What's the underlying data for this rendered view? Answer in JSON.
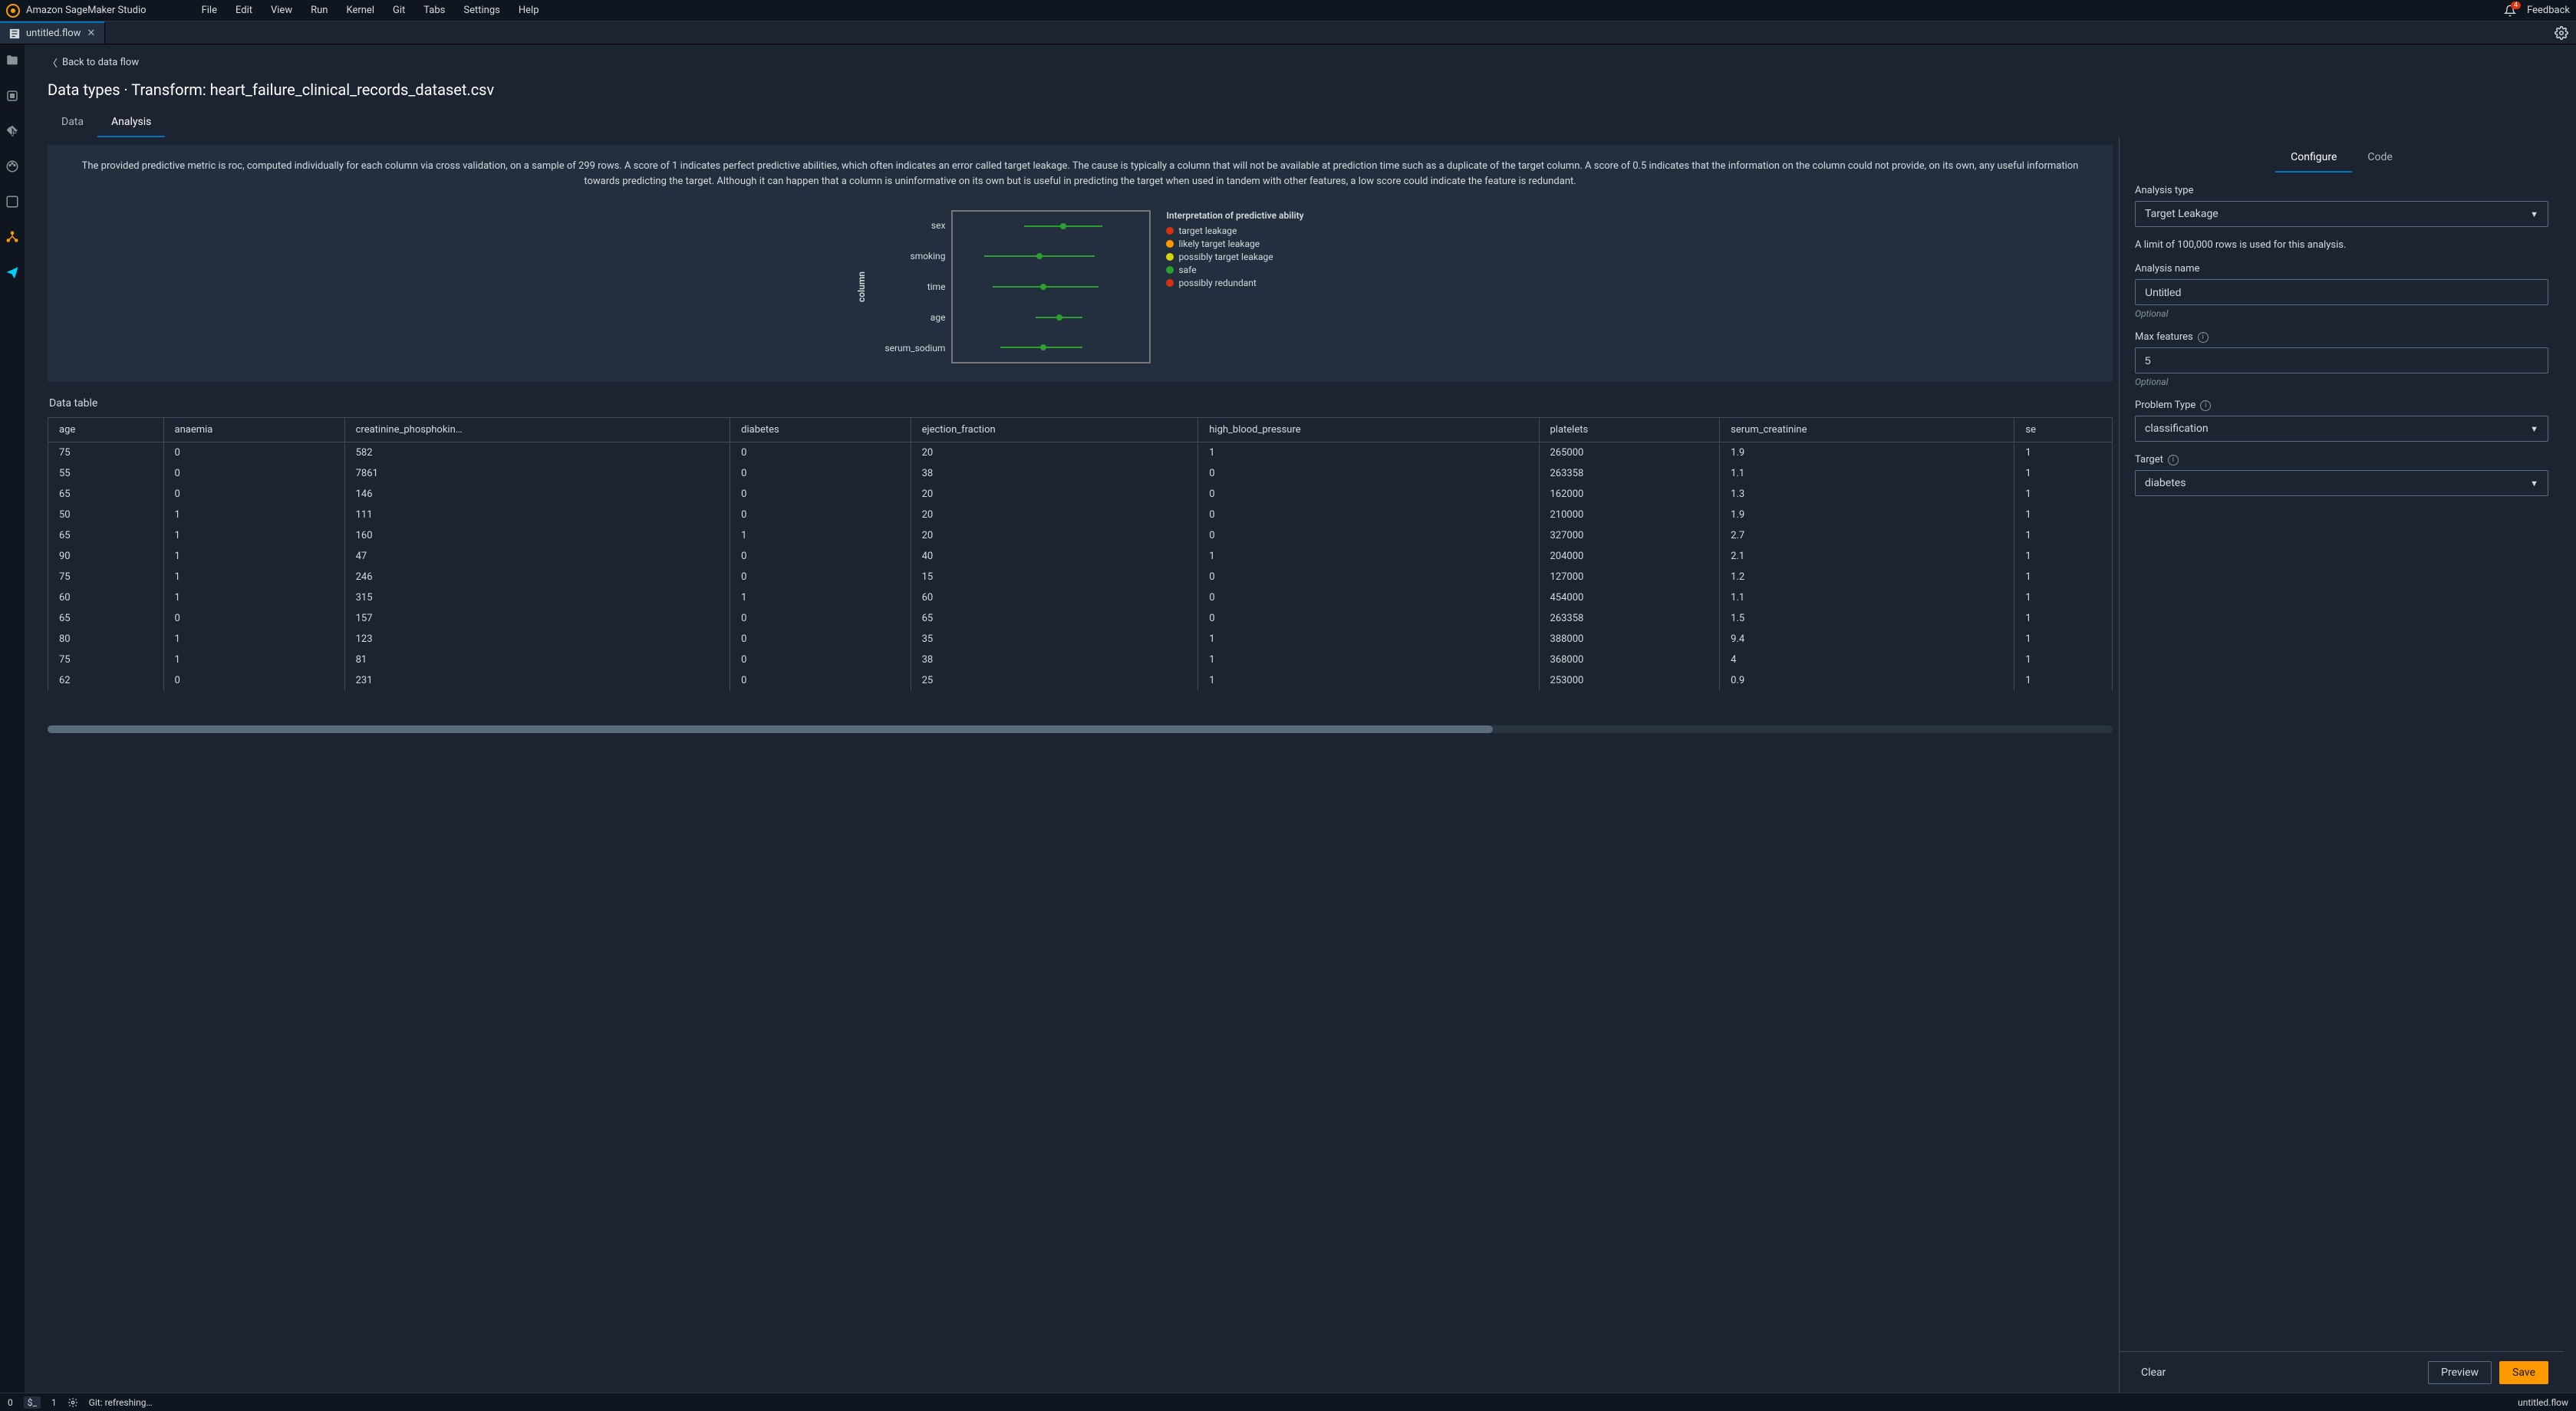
{
  "header": {
    "app_title": "Amazon SageMaker Studio",
    "menus": [
      "File",
      "Edit",
      "View",
      "Run",
      "Kernel",
      "Git",
      "Tabs",
      "Settings",
      "Help"
    ],
    "notification_count": "4",
    "feedback_label": "Feedback"
  },
  "tab": {
    "name": "untitled.flow"
  },
  "page": {
    "back_label": "Back to data flow",
    "title": "Data types · Transform: heart_failure_clinical_records_dataset.csv",
    "subtabs": {
      "data": "Data",
      "analysis": "Analysis"
    }
  },
  "analysis": {
    "explanation": "The provided predictive metric is roc, computed individually for each column via cross validation, on a sample of 299 rows. A score of 1 indicates perfect predictive abilities, which often indicates an error called target leakage. The cause is typically a column that will not be available at prediction time such as a duplicate of the target column. A score of 0.5 indicates that the information on the column could not provide, on its own, any useful information towards predicting the target. Although it can happen that a column is uninformative on its own but is useful in predicting the target when used in tandem with other features, a low score could indicate the feature is redundant.",
    "chart": {
      "ylabel": "column",
      "legend_title": "Interpretation of predictive ability",
      "legend": [
        {
          "label": "target leakage",
          "color": "#d13212"
        },
        {
          "label": "likely target leakage",
          "color": "#ff9900"
        },
        {
          "label": "possibly target leakage",
          "color": "#d4d40a"
        },
        {
          "label": "safe",
          "color": "#2ca02c"
        },
        {
          "label": "possibly redundant",
          "color": "#d13212"
        }
      ]
    }
  },
  "chart_data": {
    "type": "dot",
    "title": "Interpretation of predictive ability",
    "ylabel": "column",
    "xlabel": "",
    "xlim": [
      0.5,
      1.0
    ],
    "categories": [
      "sex",
      "smoking",
      "time",
      "age",
      "serum_sodium"
    ],
    "series": [
      {
        "name": "roc",
        "class": "safe",
        "values": [
          0.78,
          0.72,
          0.73,
          0.77,
          0.73
        ],
        "lo": [
          0.68,
          0.58,
          0.6,
          0.71,
          0.62
        ],
        "hi": [
          0.88,
          0.86,
          0.87,
          0.83,
          0.83
        ]
      }
    ]
  },
  "data_table": {
    "title": "Data table",
    "columns": [
      "age",
      "anaemia",
      "creatinine_phosphokin…",
      "diabetes",
      "ejection_fraction",
      "high_blood_pressure",
      "platelets",
      "serum_creatinine",
      "se"
    ],
    "rows": [
      [
        "75",
        "0",
        "582",
        "0",
        "20",
        "1",
        "265000",
        "1.9",
        "1"
      ],
      [
        "55",
        "0",
        "7861",
        "0",
        "38",
        "0",
        "263358",
        "1.1",
        "1"
      ],
      [
        "65",
        "0",
        "146",
        "0",
        "20",
        "0",
        "162000",
        "1.3",
        "1"
      ],
      [
        "50",
        "1",
        "111",
        "0",
        "20",
        "0",
        "210000",
        "1.9",
        "1"
      ],
      [
        "65",
        "1",
        "160",
        "1",
        "20",
        "0",
        "327000",
        "2.7",
        "1"
      ],
      [
        "90",
        "1",
        "47",
        "0",
        "40",
        "1",
        "204000",
        "2.1",
        "1"
      ],
      [
        "75",
        "1",
        "246",
        "0",
        "15",
        "0",
        "127000",
        "1.2",
        "1"
      ],
      [
        "60",
        "1",
        "315",
        "1",
        "60",
        "0",
        "454000",
        "1.1",
        "1"
      ],
      [
        "65",
        "0",
        "157",
        "0",
        "65",
        "0",
        "263358",
        "1.5",
        "1"
      ],
      [
        "80",
        "1",
        "123",
        "0",
        "35",
        "1",
        "388000",
        "9.4",
        "1"
      ],
      [
        "75",
        "1",
        "81",
        "0",
        "38",
        "1",
        "368000",
        "4",
        "1"
      ],
      [
        "62",
        "0",
        "231",
        "0",
        "25",
        "1",
        "253000",
        "0.9",
        "1"
      ]
    ]
  },
  "right_panel": {
    "tabs": {
      "configure": "Configure",
      "code": "Code"
    },
    "analysis_type_label": "Analysis type",
    "analysis_type_value": "Target Leakage",
    "row_limit_note": "A limit of 100,000 rows is used for this analysis.",
    "analysis_name_label": "Analysis name",
    "analysis_name_value": "Untitled",
    "optional": "Optional",
    "max_features_label": "Max features",
    "max_features_value": "5",
    "problem_type_label": "Problem Type",
    "problem_type_value": "classification",
    "target_label": "Target",
    "target_value": "diabetes",
    "clear": "Clear",
    "preview": "Preview",
    "save": "Save"
  },
  "statusbar": {
    "n0": "0",
    "n1": "1",
    "git": "Git: refreshing…",
    "file": "untitled.flow"
  }
}
